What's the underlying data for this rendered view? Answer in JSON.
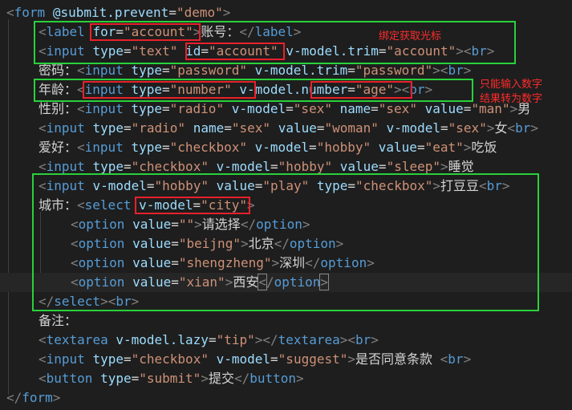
{
  "code": {
    "l1": {
      "t1": "form",
      "a1": "@submit.prevent",
      "s1": "\"demo\""
    },
    "l2": {
      "t1": "label",
      "a1": "for",
      "s1": "\"account\"",
      "x1": "账号：",
      "t2": "label"
    },
    "l3": {
      "t1": "input",
      "a1": "type",
      "s1": "\"text\"",
      "a2": "id",
      "s2": "\"account\"",
      "a3": "v-model.trim",
      "s3": "\"account\"",
      "t2": "br"
    },
    "l4": {
      "x1": "密码：",
      "t1": "input",
      "a1": "type",
      "s1": "\"password\"",
      "a2": "v-model.trim",
      "s2": "\"password\"",
      "t2": "br"
    },
    "l5": {
      "x1": "年龄：",
      "t1": "input",
      "a1": "type",
      "s1": "\"number\"",
      "a2": "v-model.number",
      "s2": "\"age\"",
      "t2": "br"
    },
    "l6": {
      "x1": "性别：",
      "t1": "input",
      "a1": "type",
      "s1": "\"radio\"",
      "a2": "v-model",
      "s2": "\"sex\"",
      "a3": "name",
      "s3": "\"sex\"",
      "a4": "value",
      "s4": "\"man\"",
      "x2": "男"
    },
    "l7": {
      "t1": "input",
      "a1": "type",
      "s1": "\"radio\"",
      "a2": "name",
      "s2": "\"sex\"",
      "a3": "value",
      "s3": "\"woman\"",
      "a4": "v-model",
      "s4": "\"sex\"",
      "x1": "女",
      "t2": "br"
    },
    "l8": {
      "x1": "爱好：",
      "t1": "input",
      "a1": "type",
      "s1": "\"checkbox\"",
      "a2": "v-model",
      "s2": "\"hobby\"",
      "a3": "value",
      "s3": "\"eat\"",
      "x2": "吃饭"
    },
    "l9": {
      "t1": "input",
      "a1": "type",
      "s1": "\"checkbox\"",
      "a2": "v-model",
      "s2": "\"hobby\"",
      "a3": "value",
      "s3": "\"sleep\"",
      "x1": "睡觉"
    },
    "l10": {
      "t1": "input",
      "a1": "v-model",
      "s1": "\"hobby\"",
      "a2": "value",
      "s2": "\"play\"",
      "a3": "type",
      "s3": "\"checkbox\"",
      "x1": "打豆豆",
      "t2": "br"
    },
    "l11": {
      "x1": "城市：",
      "t1": "select",
      "a1": "v-model",
      "s1": "\"city\""
    },
    "l12": {
      "t1": "option",
      "a1": "value",
      "s1": "\"\"",
      "x1": "请选择",
      "t2": "option"
    },
    "l13": {
      "t1": "option",
      "a1": "value",
      "s1": "\"beijng\"",
      "x1": "北京",
      "t2": "option"
    },
    "l14": {
      "t1": "option",
      "a1": "value",
      "s1": "\"shengzheng\"",
      "x1": "深圳",
      "t2": "option"
    },
    "l15": {
      "t1": "option",
      "a1": "value",
      "s1": "\"xian\"",
      "x1": "西安",
      "t2": "option"
    },
    "l16": {
      "t1": "select",
      "t2": "br"
    },
    "l17": {
      "x1": "备注："
    },
    "l18": {
      "t1": "textarea",
      "a1": "v-model.lazy",
      "s1": "\"tip\"",
      "t2": "textarea",
      "t3": "br"
    },
    "l19": {
      "t1": "input",
      "a1": "type",
      "s1": "\"checkbox\"",
      "a2": "v-model",
      "s2": "\"suggest\"",
      "x1": "是否同意条款 ",
      "t2": "br"
    },
    "l20": {
      "t1": "button",
      "a1": "type",
      "s1": "\"submit\"",
      "x1": "提交",
      "t2": "button"
    },
    "l21": {
      "t1": "form"
    }
  },
  "annotations": {
    "note1": "绑定获取光标",
    "note2": "只能输入数字",
    "note3": "结果转为数字"
  },
  "colors": {
    "background": "#1e1e1e",
    "tag": "#569cd6",
    "attribute": "#9cdcfe",
    "string": "#ce9178",
    "text": "#d4d4d4",
    "green_box": "#29d13b",
    "red_box": "#e8212b",
    "annotation": "#ff2b2b"
  }
}
